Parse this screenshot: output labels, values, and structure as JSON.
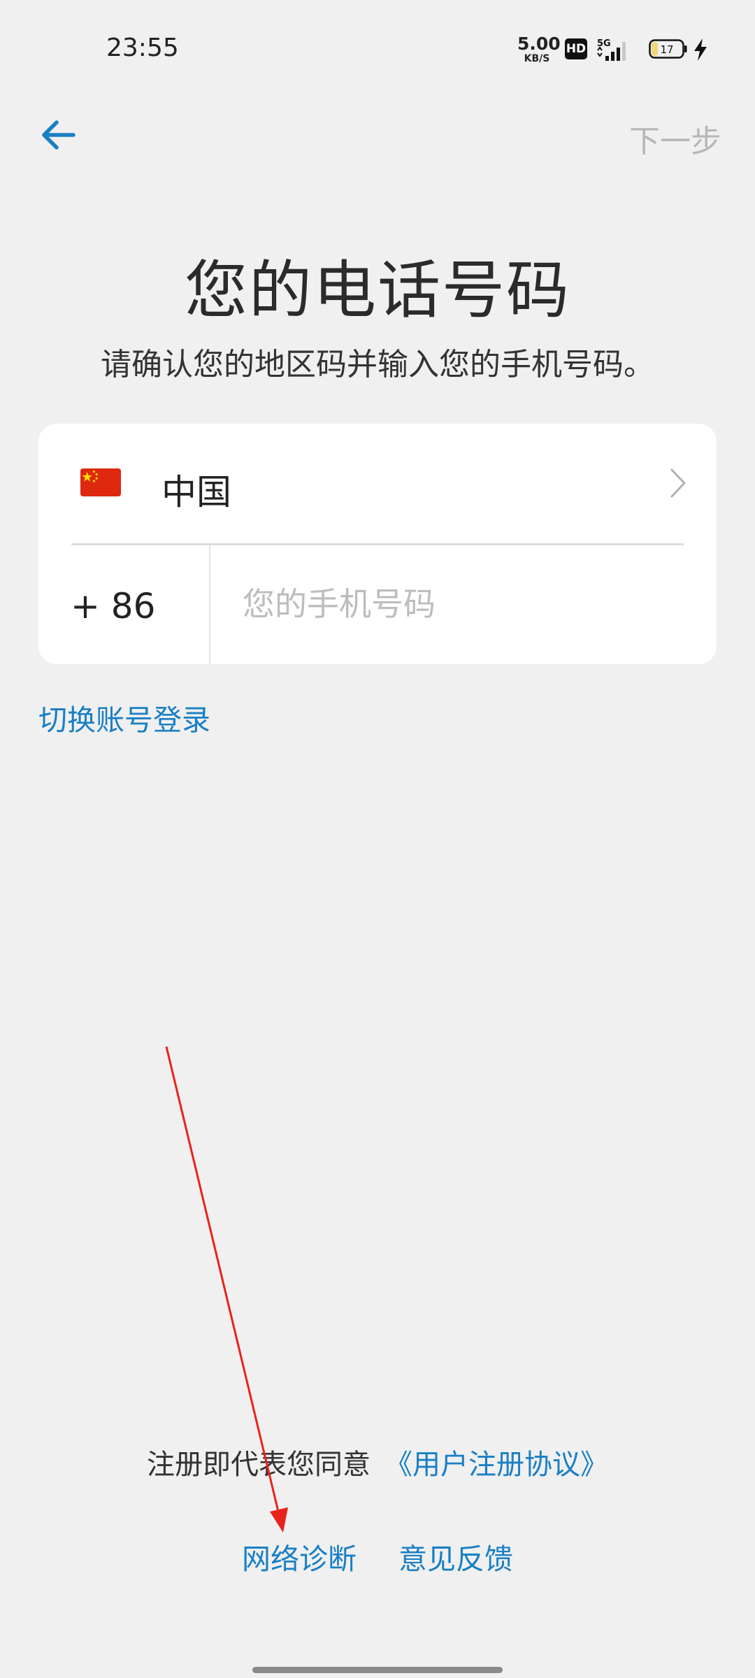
{
  "status_bar": {
    "time": "23:55",
    "net_speed_value": "5.00",
    "net_speed_unit": "KB/S",
    "hd_label": "HD",
    "network_type": "5G",
    "battery_level": "17",
    "icons": [
      "hd-icon",
      "5g-signal-icon",
      "battery-icon",
      "charging-icon"
    ]
  },
  "header": {
    "back_icon": "back-arrow-icon",
    "next_label": "下一步"
  },
  "title": "您的电话号码",
  "subtitle": "请确认您的地区码并输入您的手机号码。",
  "form": {
    "country_flag": "china-flag-icon",
    "country_name": "中国",
    "country_code": "+ 86",
    "phone_placeholder": "您的手机号码",
    "phone_value": ""
  },
  "switch_account_label": "切换账号登录",
  "agreement": {
    "text": "注册即代表您同意",
    "link": "《用户注册协议》"
  },
  "footer": {
    "network_diagnosis": "网络诊断",
    "feedback": "意见反馈"
  },
  "colors": {
    "accent": "#1a7fc4",
    "background": "#f0f0f0",
    "annotation_arrow": "#e8231b"
  }
}
